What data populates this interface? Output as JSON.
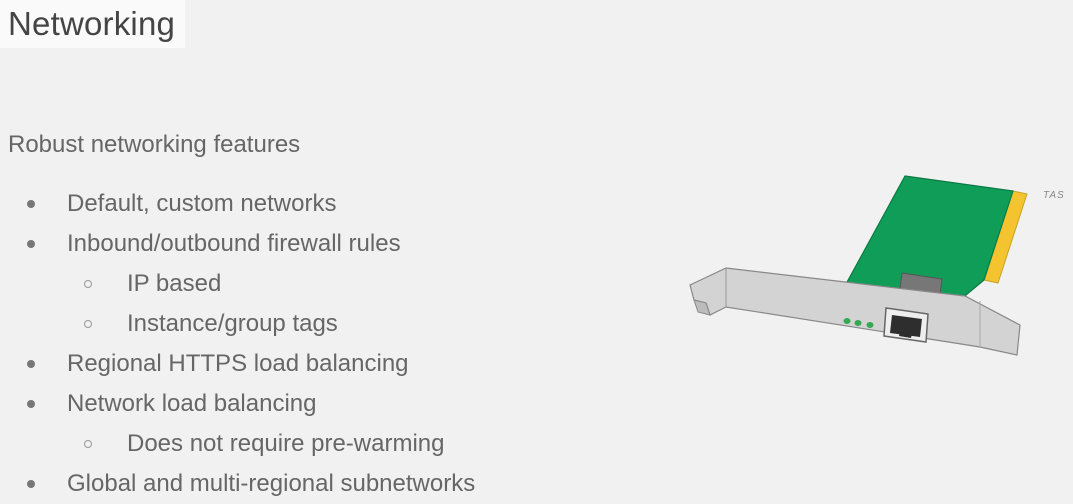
{
  "slide": {
    "title": "Networking",
    "subtitle": "Robust networking features",
    "bullets": [
      {
        "level": 1,
        "text": "Default, custom networks"
      },
      {
        "level": 1,
        "text": "Inbound/outbound firewall rules"
      },
      {
        "level": 2,
        "text": "IP based"
      },
      {
        "level": 2,
        "text": "Instance/group tags"
      },
      {
        "level": 1,
        "text": "Regional HTTPS load balancing"
      },
      {
        "level": 1,
        "text": "Network load balancing"
      },
      {
        "level": 2,
        "text": "Does not require pre-warming"
      },
      {
        "level": 1,
        "text": "Global and multi-regional subnetworks"
      }
    ],
    "illustration": {
      "icon": "network-card-icon",
      "signature": "TAS",
      "colors": {
        "board": "#0f9d58",
        "contacts": "#f4c430",
        "bracket": "#c9c9c9",
        "leds": "#34a853"
      }
    }
  }
}
